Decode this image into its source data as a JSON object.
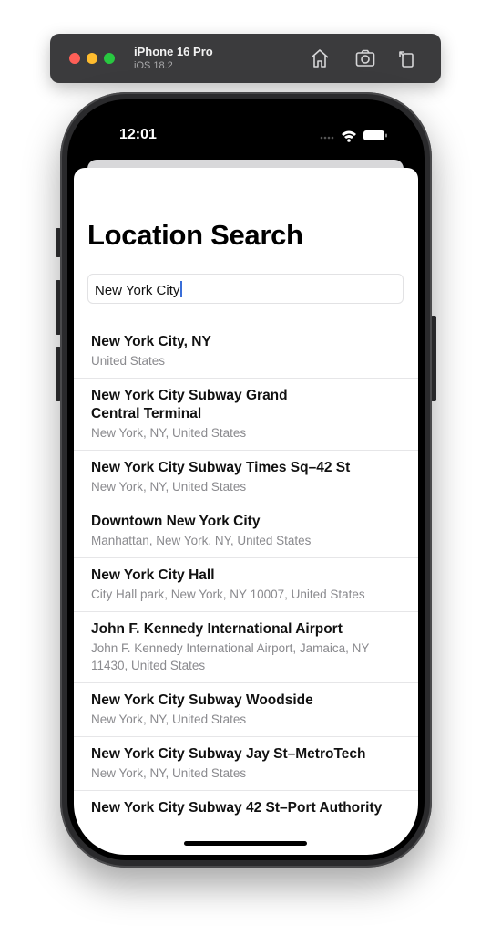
{
  "simulator": {
    "device_name": "iPhone 16 Pro",
    "os_version": "iOS 18.2",
    "icons": [
      "home-icon",
      "screenshot-camera-icon",
      "rotate-icon"
    ]
  },
  "status_bar": {
    "time": "12:01"
  },
  "screen": {
    "title": "Location Search",
    "search": {
      "value": "New York City"
    },
    "results": [
      {
        "name": "New York City, NY",
        "address": "United States"
      },
      {
        "name": "New York City Subway Grand Central Terminal",
        "address": "New York, NY, United States"
      },
      {
        "name": "New York City Subway Times Sq–42 St",
        "address": "New York, NY, United States"
      },
      {
        "name": "Downtown New York City",
        "address": "Manhattan, New York, NY, United States"
      },
      {
        "name": "New York City Hall",
        "address": "City Hall park, New York, NY 10007, United States"
      },
      {
        "name": "John F. Kennedy International Airport",
        "address": "John F. Kennedy International Airport, Jamaica, NY 11430, United States"
      },
      {
        "name": "New York City Subway Woodside",
        "address": "New York, NY, United States"
      },
      {
        "name": "New York City Subway Jay St–MetroTech",
        "address": "New York, NY, United States"
      },
      {
        "name": "New York City Subway 42 St–Port Authority",
        "address": ""
      }
    ]
  },
  "colors": {
    "accent_caret": "#3a6ed8",
    "secondary_text": "#8a8a8e",
    "toolbar_bg": "#3b3b3d"
  }
}
